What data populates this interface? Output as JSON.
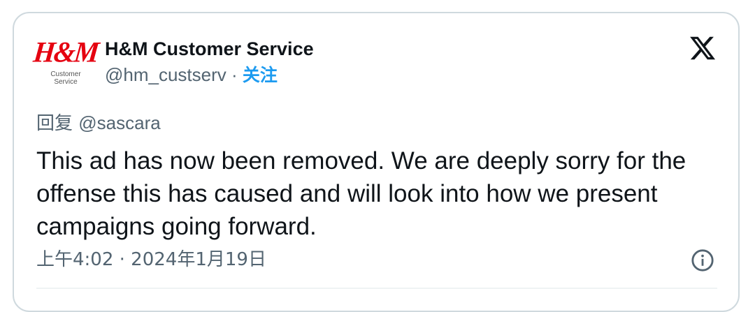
{
  "author": {
    "display_name": "H&M Customer Service",
    "handle": "@hm_custserv",
    "separator": " · ",
    "follow_label": "关注",
    "avatar": {
      "logo_text": "H&M",
      "logo_sub_line1": "Customer",
      "logo_sub_line2": "Service",
      "brand_color": "#e50010"
    }
  },
  "reply": {
    "prefix": "回复 ",
    "mention": "@sascara"
  },
  "tweet": {
    "text": "This ad has now been removed. We are deeply sorry for the offense this has caused and will look into how we present campaigns going forward."
  },
  "meta": {
    "timestamp": "上午4:02 · 2024年1月19日"
  },
  "icons": {
    "platform": "x-logo-icon",
    "info": "info-icon"
  },
  "colors": {
    "accent": "#1d9bf0",
    "secondary_text": "#536471",
    "primary_text": "#0f1419",
    "border": "#cfd9de"
  }
}
